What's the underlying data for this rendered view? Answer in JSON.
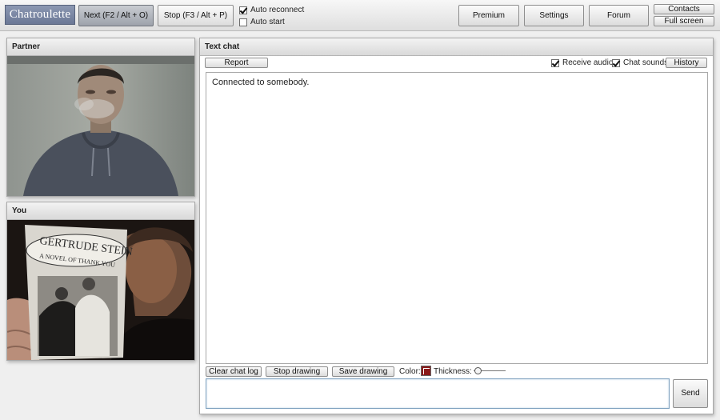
{
  "app": {
    "logo": "Chatroulette"
  },
  "toolbar": {
    "next_label": "Next (F2 / Alt + O)",
    "stop_label": "Stop (F3 / Alt + P)",
    "auto_reconnect": {
      "label": "Auto reconnect",
      "checked": true
    },
    "auto_start": {
      "label": "Auto start",
      "checked": false
    },
    "premium_label": "Premium",
    "settings_label": "Settings",
    "forum_label": "Forum",
    "contacts_label": "Contacts",
    "fullscreen_label": "Full screen"
  },
  "partner_panel": {
    "title": "Partner"
  },
  "you_panel": {
    "title": "You"
  },
  "chat": {
    "title": "Text chat",
    "report_label": "Report",
    "receive_audio": {
      "label": "Receive audio",
      "checked": true
    },
    "chat_sounds": {
      "label": "Chat sounds",
      "checked": true
    },
    "history_label": "History",
    "messages": [
      "Connected to somebody."
    ],
    "clear_label": "Clear chat log",
    "stop_drawing_label": "Stop drawing",
    "save_drawing_label": "Save drawing",
    "color_label": "Color:",
    "thickness_label": "Thickness:",
    "send_label": "Send",
    "input_value": ""
  },
  "book": {
    "title": "GERTRUDE STEIN",
    "subtitle": "A NOVEL OF THANK YOU"
  },
  "colors": {
    "logo_bg": "#7a86a4",
    "draw_color": "#8b1a1a"
  },
  "icons": [
    "checkmark-icon",
    "color-swatch-icon",
    "slider-knob-icon"
  ]
}
